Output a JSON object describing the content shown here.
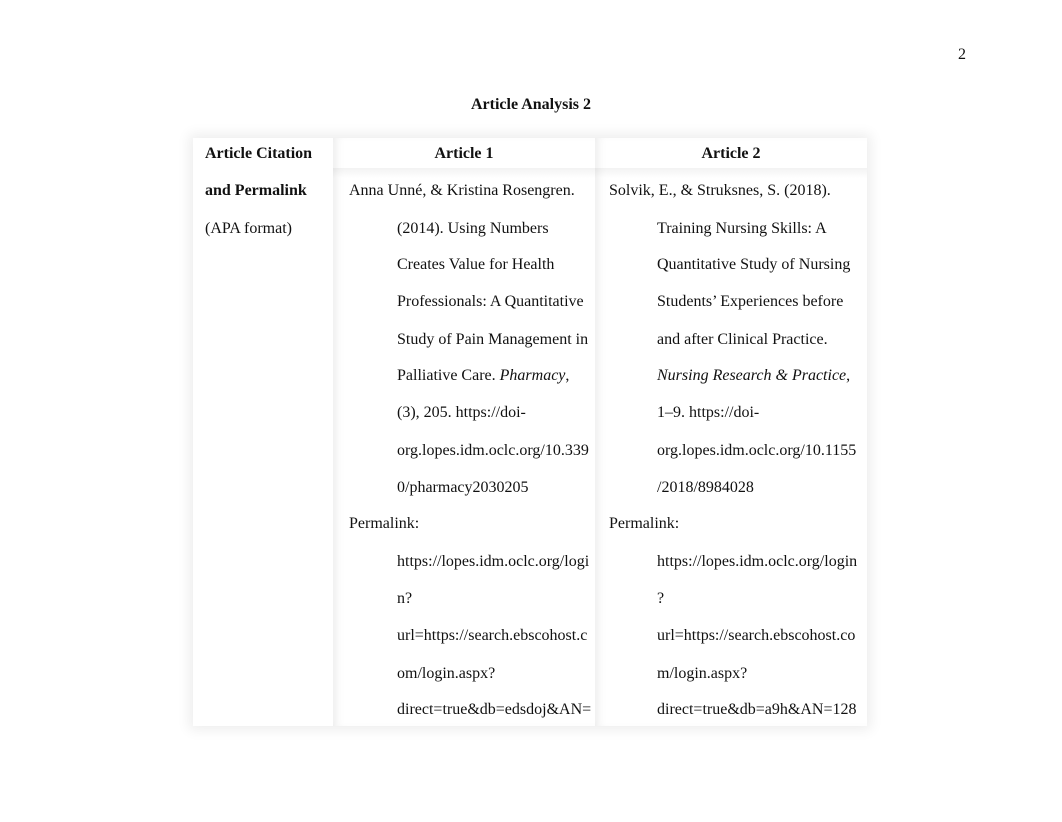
{
  "page": {
    "number": "2",
    "title": "Article Analysis 2"
  },
  "table": {
    "header": {
      "label_col_lines": [
        "Article Citation",
        "and Permalink"
      ],
      "label_note": "(APA format)",
      "article1": "Article 1",
      "article2": "Article 2"
    },
    "article1": {
      "citation_lines": [
        "Anna Unné, & Kristina Rosengren.",
        "(2014). Using Numbers",
        "Creates Value for Health",
        "Professionals: A Quantitative",
        "Study of Pain Management in",
        "Palliative Care. ",
        "(3), 205. https://doi-",
        "org.lopes.idm.oclc.org/10.339",
        "0/pharmacy2030205"
      ],
      "journal_italic": "Pharmacy",
      "journal_suffix": ",",
      "permalink_label": "Permalink:",
      "permalink_lines": [
        "https://lopes.idm.oclc.org/logi",
        "n?",
        "url=https://search.ebscohost.c",
        "om/login.aspx?",
        "direct=true&db=edsdoj&AN="
      ]
    },
    "article2": {
      "citation_lines": [
        "Solvik, E., & Struksnes, S. (2018).",
        "Training Nursing Skills: A",
        "Quantitative Study of Nursing",
        "Students’ Experiences before",
        "and after Clinical Practice.",
        "",
        "1–9. https://doi-",
        "org.lopes.idm.oclc.org/10.1155",
        "/2018/8984028"
      ],
      "journal_italic": "Nursing Research & Practice",
      "journal_suffix": ",",
      "permalink_label": "Permalink:",
      "permalink_lines": [
        "https://lopes.idm.oclc.org/login",
        "?",
        "url=https://search.ebscohost.co",
        "m/login.aspx?",
        "direct=true&db=a9h&AN=128"
      ]
    }
  }
}
